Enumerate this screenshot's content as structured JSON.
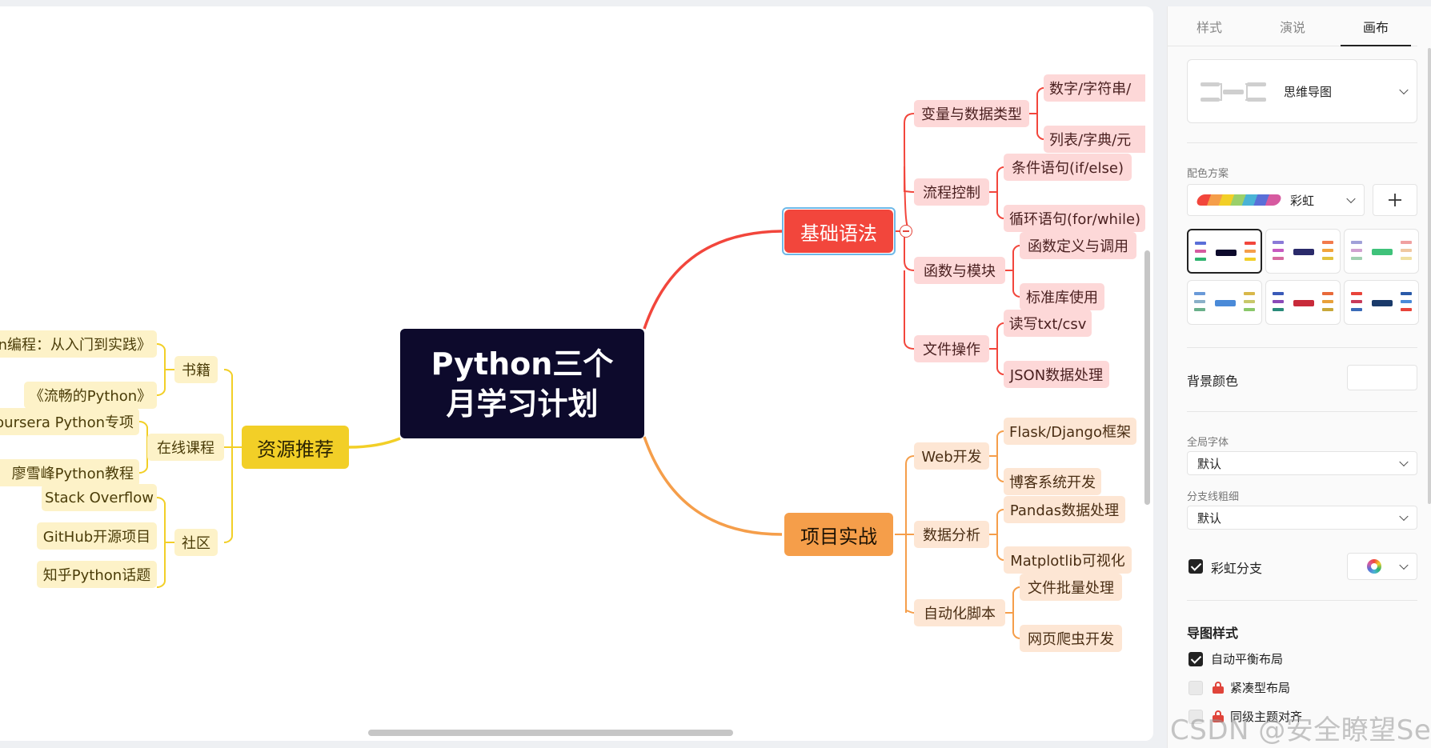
{
  "mindmap": {
    "center": "Python三个月学习计划",
    "branches": {
      "basics": {
        "label": "基础语法",
        "children": [
          {
            "label": "变量与数据类型",
            "leaves": [
              "数字/字符串/",
              "列表/字典/元"
            ]
          },
          {
            "label": "流程控制",
            "leaves": [
              "条件语句(if/else)",
              "循环语句(for/while)"
            ]
          },
          {
            "label": "函数与模块",
            "leaves": [
              "函数定义与调用",
              "标准库使用"
            ]
          },
          {
            "label": "文件操作",
            "leaves": [
              "读写txt/csv",
              "JSON数据处理"
            ]
          }
        ]
      },
      "projects": {
        "label": "项目实战",
        "children": [
          {
            "label": "Web开发",
            "leaves": [
              "Flask/Django框架",
              "博客系统开发"
            ]
          },
          {
            "label": "数据分析",
            "leaves": [
              "Pandas数据处理",
              "Matplotlib可视化"
            ]
          },
          {
            "label": "自动化脚本",
            "leaves": [
              "文件批量处理",
              "网页爬虫开发"
            ]
          }
        ]
      },
      "resources": {
        "label": "资源推荐",
        "children": [
          {
            "label": "书籍",
            "leaves": [
              "n编程：从入门到实践》",
              "《流畅的Python》"
            ]
          },
          {
            "label": "在线课程",
            "leaves": [
              "oursera Python专项",
              "廖雪峰Python教程"
            ]
          },
          {
            "label": "社区",
            "leaves": [
              "Stack Overflow",
              "GitHub开源项目",
              "知乎Python话题"
            ]
          }
        ]
      }
    },
    "colors": {
      "red": "#f2463c",
      "orange": "#f59e4a",
      "yellow": "#f2cf27",
      "center_bg": "#0d0a2c"
    }
  },
  "panel": {
    "tabs": [
      "样式",
      "演说",
      "画布"
    ],
    "active_tab": "画布",
    "structure": "思维导图",
    "color_scheme_label": "配色方案",
    "color_scheme_value": "彩虹",
    "add_icon": "plus-icon",
    "bg_color_label": "背景颜色",
    "font_label": "全局字体",
    "font_value": "默认",
    "line_width_label": "分支线粗细",
    "line_width_value": "默认",
    "rainbow_branch_label": "彩虹分支",
    "rainbow_branch_checked": true,
    "map_style_title": "导图样式",
    "options": [
      {
        "label": "自动平衡布局",
        "checked": true,
        "locked": false
      },
      {
        "label": "紧凑型布局",
        "checked": false,
        "locked": true
      },
      {
        "label": "同级主题对齐",
        "checked": false,
        "locked": true
      }
    ]
  },
  "watermark": "CSDN @安全瞭望Sec"
}
